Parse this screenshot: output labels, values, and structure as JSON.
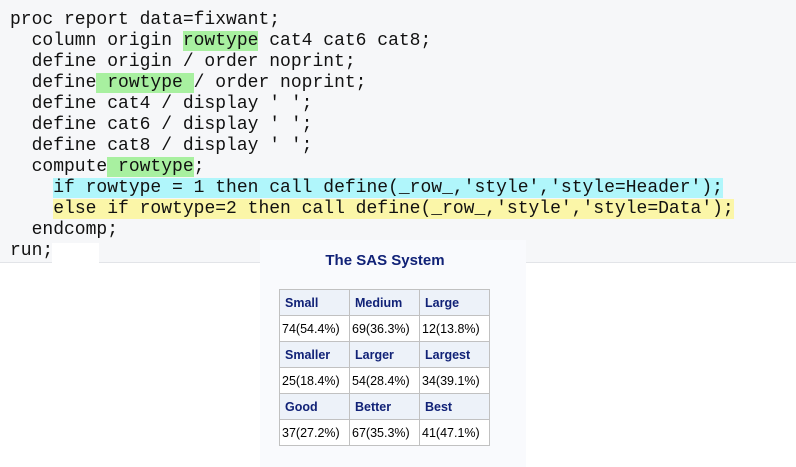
{
  "code": {
    "lines": [
      "proc report data=fixwant;",
      "  column origin ",
      "rowtype",
      " cat4 cat6 cat8;",
      "  define origin / order noprint;",
      "  define",
      " rowtype ",
      "/ order noprint;",
      "  define cat4 / display ' ';",
      "  define cat6 / display ' ';",
      "  define cat8 / display ' ';",
      "  compute",
      " rowtype",
      ";",
      "if rowtype = 1 then call define(_row_,'style','style=Header');",
      "else if rowtype=2 then call define(_row_,'style','style=Data');",
      "  endcomp;",
      "run;"
    ],
    "highlight_colors": {
      "green": "#a8f0a0",
      "cyan": "#b0f6fb",
      "yellow": "#fbf6a8"
    }
  },
  "output": {
    "title": "The SAS System",
    "rows": [
      {
        "type": "header",
        "cells": [
          "Small",
          "Medium",
          "Large"
        ]
      },
      {
        "type": "data",
        "cells": [
          "74(54.4%)",
          "69(36.3%)",
          "12(13.8%)"
        ]
      },
      {
        "type": "header",
        "cells": [
          "Smaller",
          "Larger",
          "Largest"
        ]
      },
      {
        "type": "data",
        "cells": [
          "25(18.4%)",
          "54(28.4%)",
          "34(39.1%)"
        ]
      },
      {
        "type": "header",
        "cells": [
          "Good",
          "Better",
          "Best"
        ]
      },
      {
        "type": "data",
        "cells": [
          "37(27.2%)",
          "67(35.3%)",
          "41(47.1%)"
        ]
      }
    ]
  }
}
